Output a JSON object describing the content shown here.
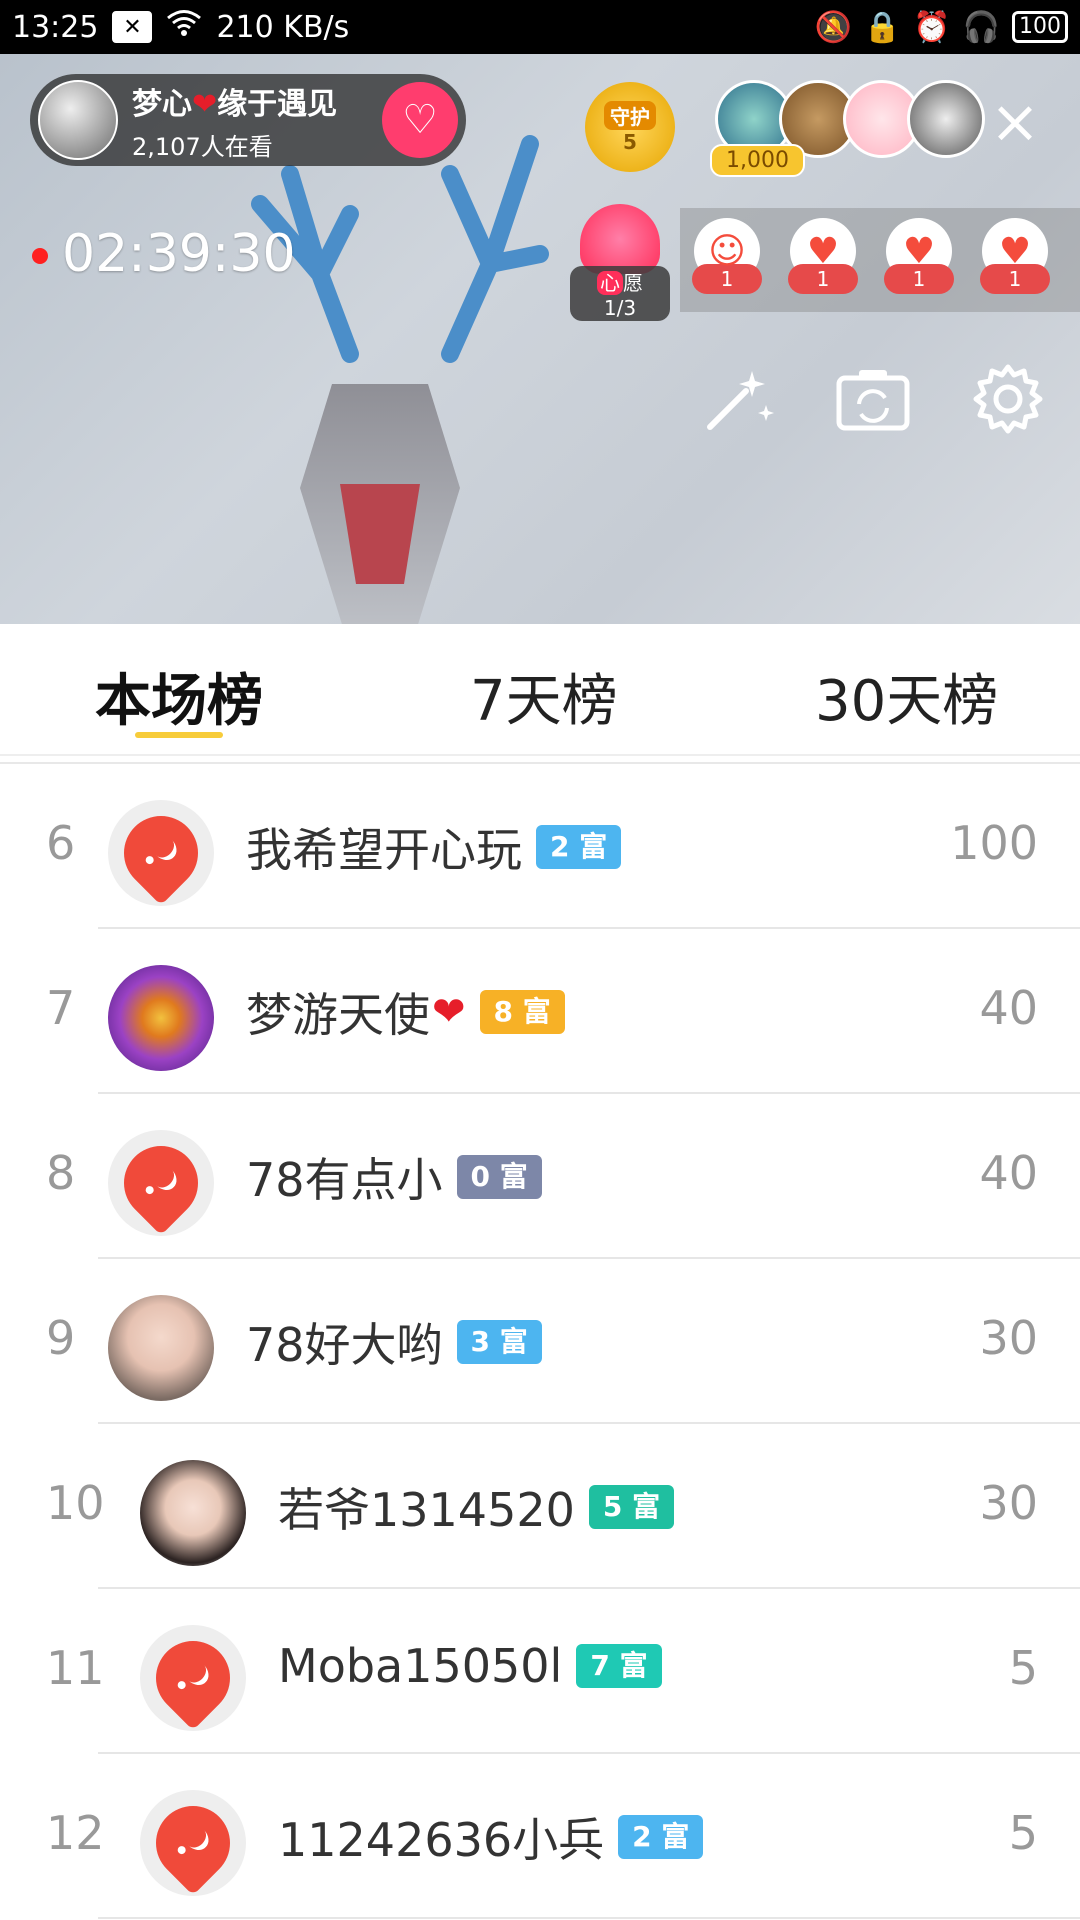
{
  "status_bar": {
    "time": "13:25",
    "network_speed": "210 KB/s",
    "battery": "100"
  },
  "live": {
    "host_name": "梦心",
    "host_name_suffix": "缘于遇见",
    "viewers": "2,107人在看",
    "guard_label": "守护",
    "guard_count": "5",
    "viewer_count_badge": "1,000",
    "timer": "02:39:30",
    "wish_prefix": "心",
    "wish_label": "愿 1/3",
    "gifts": [
      {
        "count": "1"
      },
      {
        "count": "1"
      },
      {
        "count": "1"
      },
      {
        "count": "1"
      }
    ]
  },
  "tabs": {
    "current": "本场榜",
    "seven_day": "7天榜",
    "thirty_day": "30天榜"
  },
  "leaderboard": [
    {
      "rank": "6",
      "name": "我希望开心玩",
      "heart": "",
      "badge": "2 富",
      "badge_color": "#4db5f0",
      "score": "100"
    },
    {
      "rank": "7",
      "name": "梦游天使",
      "heart": "❤",
      "badge": "8 富",
      "badge_color": "#f7b126",
      "score": "40"
    },
    {
      "rank": "8",
      "name": "78有点小",
      "heart": "",
      "badge": "0 富",
      "badge_color": "#7d87a8",
      "score": "40"
    },
    {
      "rank": "9",
      "name": "78好大哟",
      "heart": "",
      "badge": "3 富",
      "badge_color": "#4db5f0",
      "score": "30"
    },
    {
      "rank": "10",
      "name": "若爷1314520",
      "heart": "",
      "badge": "5 富",
      "badge_color": "#1fbfa0",
      "score": "30"
    },
    {
      "rank": "11",
      "name": "Moba15050l",
      "heart": "",
      "badge": "7 富",
      "badge_color": "#1fc9b4",
      "score": "5"
    },
    {
      "rank": "12",
      "name": "11242636小兵",
      "heart": "",
      "badge": "2 富",
      "badge_color": "#4db5f0",
      "score": "5"
    }
  ]
}
